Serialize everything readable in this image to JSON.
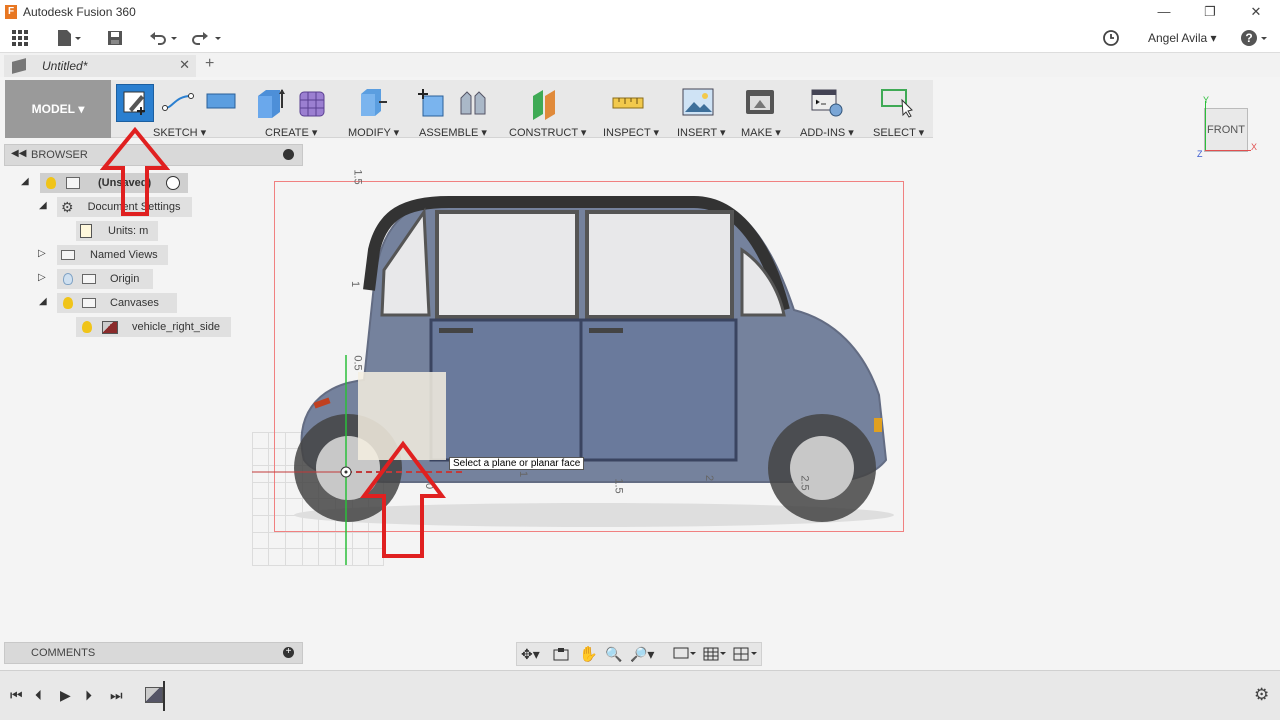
{
  "window": {
    "title": "Autodesk Fusion 360"
  },
  "user": {
    "name": "Angel Avila"
  },
  "document_tab": {
    "label": "Untitled*"
  },
  "ribbon": {
    "workspace": "MODEL",
    "groups": [
      "SKETCH",
      "CREATE",
      "MODIFY",
      "ASSEMBLE",
      "CONSTRUCT",
      "INSPECT",
      "INSERT",
      "MAKE",
      "ADD-INS",
      "SELECT"
    ]
  },
  "browser": {
    "title": "BROWSER",
    "items": [
      {
        "label": "(Unsaved)"
      },
      {
        "label": "Document Settings"
      },
      {
        "label": "Units: m"
      },
      {
        "label": "Named Views"
      },
      {
        "label": "Origin"
      },
      {
        "label": "Canvases"
      },
      {
        "label": "vehicle_right_side"
      }
    ]
  },
  "comments": {
    "title": "COMMENTS"
  },
  "viewport": {
    "tooltip": "Select a plane or planar face",
    "ruler_labels": [
      "1.5",
      "1",
      "0.5",
      "0",
      "1",
      "1.5",
      "2",
      "2.5"
    ]
  },
  "viewcube": {
    "face": "FRONT",
    "axes": [
      "Y",
      "X",
      "Z"
    ]
  },
  "colors": {
    "accent": "#1e7ac8",
    "annotation": "#e02020",
    "frame": "#f08080"
  }
}
